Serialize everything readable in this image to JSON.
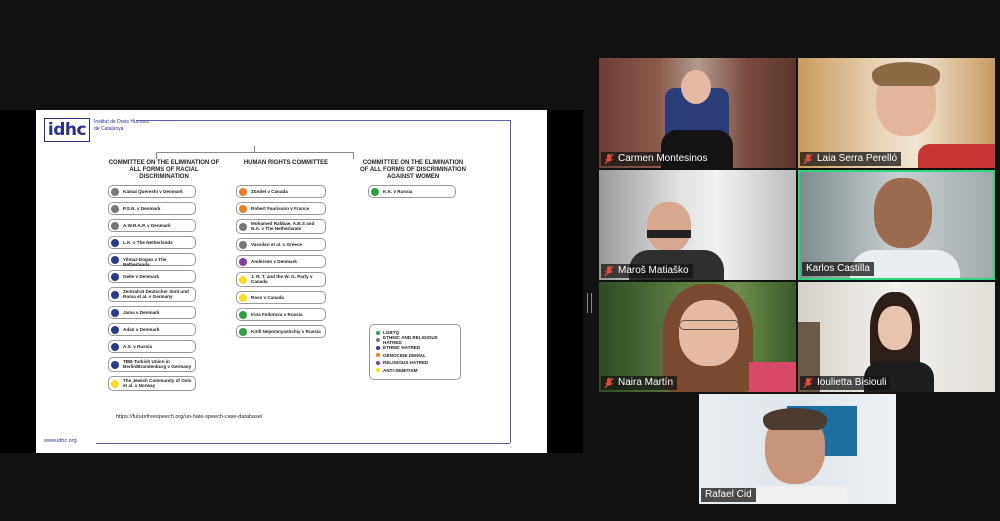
{
  "slide": {
    "logo_text": "idhc",
    "logo_sub": "Institut de Drets Humans de Catalunya",
    "site": "www.idhc.org",
    "url": "https://futurefreespeech.org/un-hate-speech-case-database/",
    "columns": [
      {
        "title": "COMMITTEE ON THE ELIMINATION OF ALL FORMS OF RACIAL DISCRIMINATION"
      },
      {
        "title": "HUMAN RIGHTS COMMITTEE"
      },
      {
        "title": "COMMITTEE ON THE ELIMINATION OF ALL FORMS OF DISCRIMINATION AGAINST WOMEN"
      }
    ],
    "cerd_cases": [
      {
        "label": "Kamal Quereshi v Denmark",
        "color": "#777777"
      },
      {
        "label": "P.S.N. v Denmark",
        "color": "#777777"
      },
      {
        "label": "A.W.R.A.P. v Denmark",
        "color": "#777777"
      },
      {
        "label": "L.K. v The Netherlands",
        "color": "#2b3a8c"
      },
      {
        "label": "Yilmaz-Dogan v The Netherlands",
        "color": "#2b3a8c"
      },
      {
        "label": "Gelle v Denmark",
        "color": "#2b3a8c"
      },
      {
        "label": "Zentralrat Deutscher Sinti und Roma et al. v Germany",
        "color": "#2b3a8c"
      },
      {
        "label": "Jama v Denmark",
        "color": "#2b3a8c"
      },
      {
        "label": "Adan v Denmark",
        "color": "#2b3a8c"
      },
      {
        "label": "A.S. v Russia",
        "color": "#2b3a8c"
      },
      {
        "label": "TBB-Turkish Union in Berlin/Brandenburg v Germany",
        "color": "#2b3a8c"
      },
      {
        "label": "The Jewish Community of Oslo et al. v Norway",
        "color": "#f4e11a"
      }
    ],
    "hrc_cases": [
      {
        "label": "Zündel v Canada",
        "color": "#f07d22"
      },
      {
        "label": "Robert Faurisson v France",
        "color": "#f07d22"
      },
      {
        "label": "Mohamed Rabbae, A.B.S and N.A. v The Netherlands",
        "color": "#777777"
      },
      {
        "label": "Vassilari et al. v Greece",
        "color": "#777777"
      },
      {
        "label": "Andersen v Denmark",
        "color": "#7b3f98"
      },
      {
        "label": "J. R. T. and the W. G. Party v Canada",
        "color": "#f4e11a"
      },
      {
        "label": "Ross v Canada",
        "color": "#f4e11a"
      },
      {
        "label": "Irina Fedotova v Russia",
        "color": "#2ea043"
      },
      {
        "label": "Kirill Nepomnyashchiy v Russia",
        "color": "#2ea043"
      }
    ],
    "cedaw_cases": [
      {
        "label": "K.K. v Russia",
        "color": "#2ea043"
      }
    ],
    "legend": [
      {
        "label": "LGBTQ",
        "color": "#2ea043"
      },
      {
        "label": "ETHNIC AND RELIGIOUS HATRED",
        "color": "#777777"
      },
      {
        "label": "ETHNIC HATRED",
        "color": "#2b3a8c"
      },
      {
        "label": "GENOCIDE DENIAL",
        "color": "#f07d22"
      },
      {
        "label": "RELIGIOUS HATRED",
        "color": "#7b3f98"
      },
      {
        "label": "ANTI-SEMITISM",
        "color": "#f4e11a"
      }
    ]
  },
  "participants": [
    {
      "name": "Carmen Montesinos",
      "muted": true,
      "active": false
    },
    {
      "name": "Laia Serra Perelló",
      "muted": true,
      "active": false
    },
    {
      "name": "Maroš Matiaško",
      "muted": true,
      "active": false
    },
    {
      "name": "Karlos Castilla",
      "muted": false,
      "active": true
    },
    {
      "name": "Naira Martín",
      "muted": true,
      "active": false
    },
    {
      "name": "Ioulietta Bisiouli",
      "muted": true,
      "active": false
    },
    {
      "name": "Rafael Cid",
      "muted": false,
      "active": false
    }
  ]
}
